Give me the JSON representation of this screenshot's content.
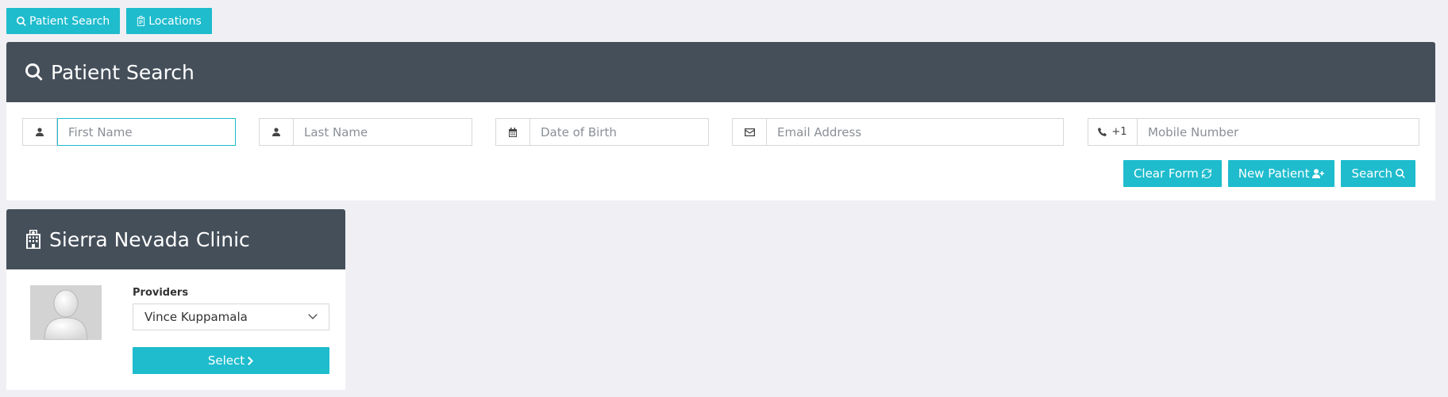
{
  "topbar": {
    "patient_search_label": "Patient Search",
    "locations_label": "Locations"
  },
  "search_panel": {
    "title": "Patient Search",
    "fields": {
      "first_name_placeholder": "First Name",
      "last_name_placeholder": "Last Name",
      "dob_placeholder": "Date of Birth",
      "email_placeholder": "Email Address",
      "country_code": "+1",
      "mobile_placeholder": "Mobile Number"
    },
    "actions": {
      "clear_label": "Clear Form",
      "new_patient_label": "New Patient",
      "search_label": "Search"
    }
  },
  "clinic_panel": {
    "title": "Sierra Nevada Clinic",
    "providers_label": "Providers",
    "selected_provider": "Vince Kuppamala",
    "select_label": "Select"
  },
  "colors": {
    "accent": "#1ebccd",
    "panel_header": "#454f5a",
    "background": "#f0f0f4"
  },
  "icons": [
    "search-icon",
    "clipboard-icon",
    "user-icon",
    "calendar-icon",
    "envelope-icon",
    "phone-icon",
    "refresh-icon",
    "user-plus-icon",
    "hospital-icon",
    "chevron-down-icon",
    "chevron-right-icon"
  ]
}
